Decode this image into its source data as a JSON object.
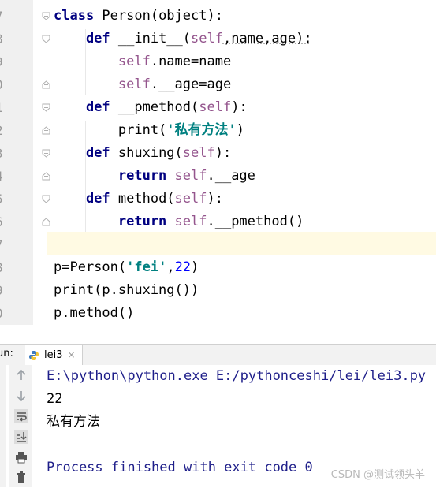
{
  "editor": {
    "line_numbers": [
      "7",
      "8",
      "9",
      "0",
      "1",
      "2",
      "3",
      "4",
      "5",
      "6",
      "7",
      "8",
      "9",
      "0"
    ],
    "lines": [
      [
        {
          "t": "class",
          "c": "kw"
        },
        {
          "t": " Person(object):",
          "c": "pn"
        }
      ],
      [
        {
          "t": "    def",
          "c": "kw"
        },
        {
          "t": " __init__(",
          "c": "pn"
        },
        {
          "t": "self",
          "c": "sf"
        },
        {
          "t": ",name,age):",
          "c": "pnw"
        }
      ],
      [
        {
          "t": "        self",
          "c": "sf"
        },
        {
          "t": ".name=name",
          "c": "pn"
        }
      ],
      [
        {
          "t": "        self",
          "c": "sf"
        },
        {
          "t": ".__age=age",
          "c": "pn"
        }
      ],
      [
        {
          "t": "    def",
          "c": "kw"
        },
        {
          "t": " __pmethod(",
          "c": "pn"
        },
        {
          "t": "self",
          "c": "sf"
        },
        {
          "t": "):",
          "c": "pn"
        }
      ],
      [
        {
          "t": "        print(",
          "c": "pn"
        },
        {
          "t": "'私有方法'",
          "c": "st"
        },
        {
          "t": ")",
          "c": "pn"
        }
      ],
      [
        {
          "t": "    def",
          "c": "kw"
        },
        {
          "t": " shuxing(",
          "c": "pn"
        },
        {
          "t": "self",
          "c": "sf"
        },
        {
          "t": "):",
          "c": "pn"
        }
      ],
      [
        {
          "t": "        return",
          "c": "kw"
        },
        {
          "t": " self",
          "c": "sf"
        },
        {
          "t": ".__age",
          "c": "pn"
        }
      ],
      [
        {
          "t": "    def",
          "c": "kw"
        },
        {
          "t": " method(",
          "c": "pn"
        },
        {
          "t": "self",
          "c": "sf"
        },
        {
          "t": "):",
          "c": "pn"
        }
      ],
      [
        {
          "t": "        return",
          "c": "kw"
        },
        {
          "t": " self",
          "c": "sf"
        },
        {
          "t": ".__pmethod()",
          "c": "pn"
        }
      ],
      [
        {
          "t": "",
          "c": "pn"
        }
      ],
      [
        {
          "t": "p=Person(",
          "c": "pn"
        },
        {
          "t": "'fei'",
          "c": "st"
        },
        {
          "t": ",",
          "c": "pn"
        },
        {
          "t": "22",
          "c": "num"
        },
        {
          "t": ")",
          "c": "pn"
        }
      ],
      [
        {
          "t": "print(p.shuxing())",
          "c": "pn"
        }
      ],
      [
        {
          "t": "p.method()",
          "c": "pn"
        }
      ]
    ]
  },
  "run": {
    "title": "un:",
    "tab_label": "lei3",
    "tab_close": "×",
    "console": [
      "E:\\python\\python.exe E:/pythonceshi/lei/lei3.py",
      "22",
      "私有方法",
      "",
      "Process finished with exit code 0"
    ]
  },
  "icons": {
    "tab_icon": "python-file-icon",
    "toolbar": [
      "rerun-up-icon",
      "rerun-down-icon",
      "soft-wrap-icon",
      "scroll-to-end-icon",
      "print-icon",
      "trash-icon"
    ]
  },
  "watermark": "CSDN @测试领头羊"
}
